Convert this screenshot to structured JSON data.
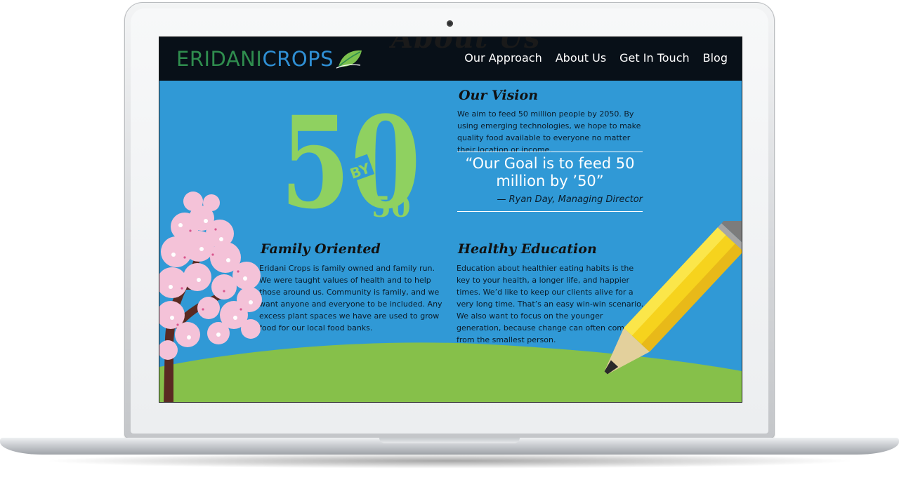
{
  "brand": {
    "name_part1": "ERIDANI",
    "name_part2": "CROPS",
    "logo_icon": "leaf-icon",
    "green": "#2f8d4e",
    "blue": "#2f8fd4"
  },
  "header": {
    "ghost_heading": "About Us"
  },
  "nav": {
    "items": [
      {
        "label": "Our Approach"
      },
      {
        "label": "About Us"
      },
      {
        "label": "Get In Touch"
      },
      {
        "label": "Blog"
      }
    ]
  },
  "graphic": {
    "big_number": "50",
    "by": "BY",
    "small_number": "50"
  },
  "vision": {
    "heading": "Our Vision",
    "body": "We aim to feed 50 million people by 2050. By using emerging technologies, we hope to make quality food available to everyone no matter their location or income."
  },
  "quote": {
    "text": "“Our Goal is to feed 50 million by ’50”",
    "attribution": "— Ryan Day, Managing Director"
  },
  "family": {
    "heading": "Family Oriented",
    "body": "Eridani Crops is family owned and family run. We were taught values of health and to help those around us. Community is family, and we want anyone and everyone to be included. Any excess plant spaces we have are used to grow food for our local food banks."
  },
  "education": {
    "heading": "Healthy Education",
    "body": "Education about healthier eating habits is the key to your health, a longer life, and happier times. We’d like to keep our clients alive for a very long time. That’s an easy win-win scenario. We also want to focus on the younger generation, because change can often come from the smallest person."
  },
  "colors": {
    "page_background": "#3099d6",
    "nav_background": "#081018",
    "hill": "#86c04a",
    "fifty_green": "#8fd160"
  }
}
